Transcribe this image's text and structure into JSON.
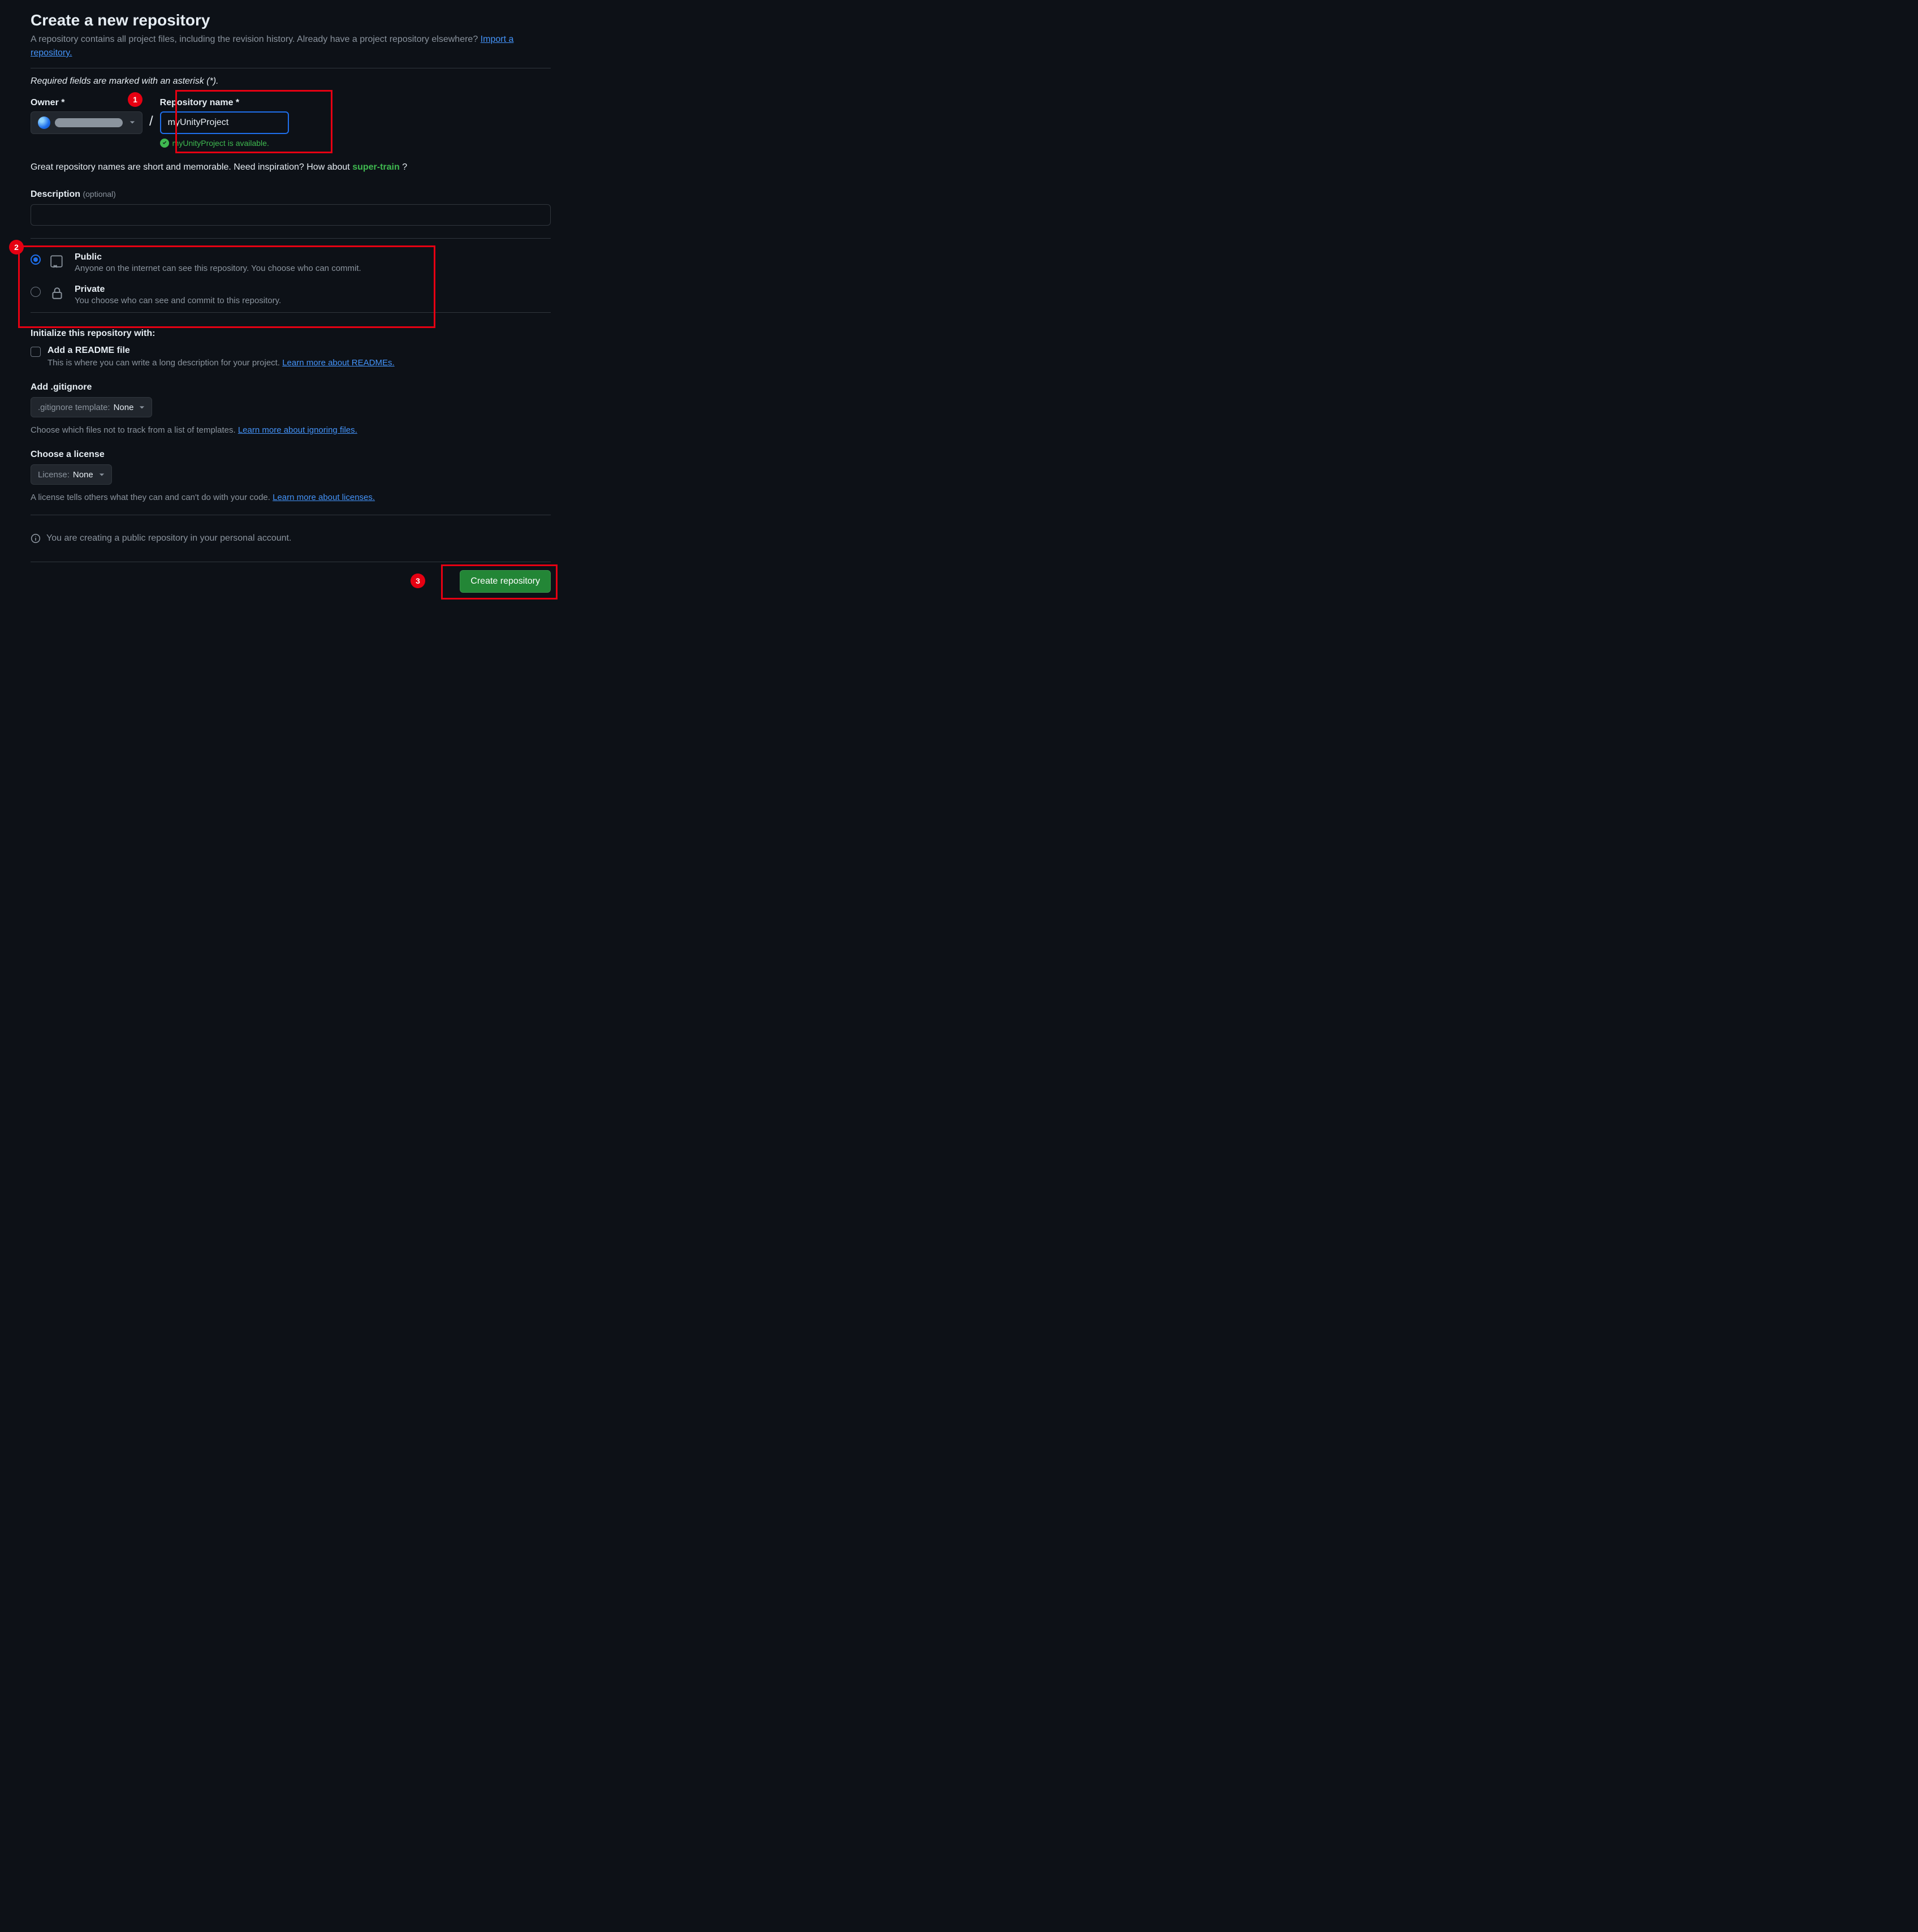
{
  "header": {
    "title": "Create a new repository",
    "subtitlePrefix": "A repository contains all project files, including the revision history. Already have a project repository elsewhere? ",
    "importLink": "Import a repository.",
    "requiredNote": "Required fields are marked with an asterisk (*)."
  },
  "owner": {
    "label": "Owner *",
    "separator": "/"
  },
  "repoName": {
    "label": "Repository name *",
    "value": "myUnityProject",
    "availabilityText": "myUnityProject is available."
  },
  "tip": {
    "prefix": "Great repository names are short and memorable. Need inspiration? How about ",
    "suggestion": "super-train",
    "suffix": " ?"
  },
  "description": {
    "labelMain": "Description",
    "labelOptional": "(optional)",
    "value": ""
  },
  "visibility": {
    "public": {
      "title": "Public",
      "desc": "Anyone on the internet can see this repository. You choose who can commit."
    },
    "private": {
      "title": "Private",
      "desc": "You choose who can see and commit to this repository."
    }
  },
  "initialize": {
    "heading": "Initialize this repository with:",
    "readme": {
      "title": "Add a README file",
      "descPrefix": "This is where you can write a long description for your project. ",
      "descLink": "Learn more about READMEs."
    }
  },
  "gitignore": {
    "heading": "Add .gitignore",
    "dropdownPrefix": ".gitignore template: ",
    "dropdownValue": "None",
    "helperPrefix": "Choose which files not to track from a list of templates. ",
    "helperLink": "Learn more about ignoring files."
  },
  "license": {
    "heading": "Choose a license",
    "dropdownPrefix": "License: ",
    "dropdownValue": "None",
    "helperPrefix": "A license tells others what they can and can't do with your code. ",
    "helperLink": "Learn more about licenses."
  },
  "infoMessage": "You are creating a public repository in your personal account.",
  "createButton": "Create repository",
  "callouts": {
    "c1": "1",
    "c2": "2",
    "c3": "3"
  }
}
